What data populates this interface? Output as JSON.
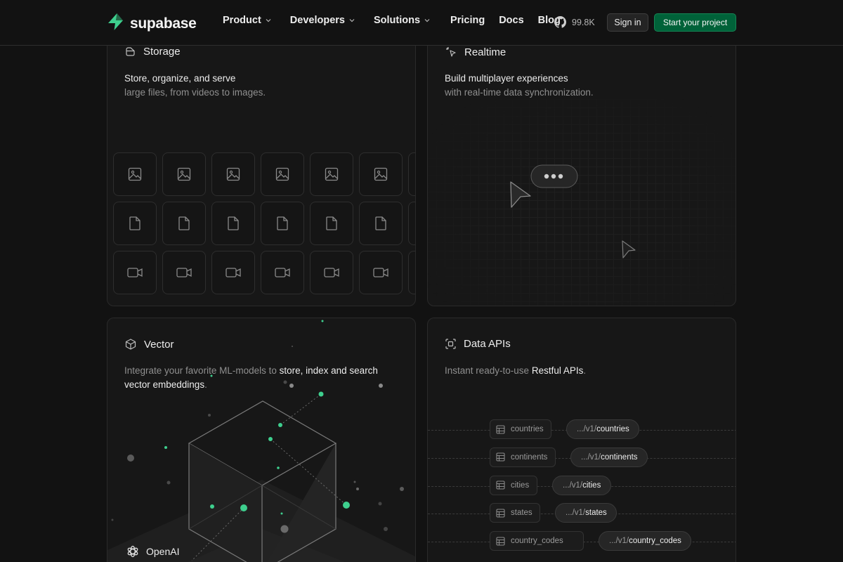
{
  "nav": {
    "brand": "supabase",
    "menu": [
      {
        "label": "Product",
        "dropdown": true
      },
      {
        "label": "Developers",
        "dropdown": true
      },
      {
        "label": "Solutions",
        "dropdown": true
      },
      {
        "label": "Pricing",
        "dropdown": false
      },
      {
        "label": "Docs",
        "dropdown": false
      },
      {
        "label": "Blog",
        "dropdown": false
      }
    ],
    "github_stars": "99.8K",
    "signin_label": "Sign in",
    "start_label": "Start your project"
  },
  "storage": {
    "title": "Storage",
    "desc_line1": "Store, organize, and serve",
    "desc_line2": "large files, from videos to images."
  },
  "realtime": {
    "title": "Realtime",
    "desc_line1": "Build multiplayer experiences",
    "desc_line2": "with real-time data synchronization."
  },
  "vector": {
    "title": "Vector",
    "desc_a": "Integrate your favorite ML-models to ",
    "desc_b": "store, index and search",
    "desc_c": "vector embeddings",
    "desc_d": ".",
    "provider": "OpenAI"
  },
  "apis": {
    "title": "Data APIs",
    "desc_a": "Instant ready-to-use ",
    "desc_b": "Restful APIs",
    "desc_c": ".",
    "rows": [
      {
        "table": "countries",
        "prefix": ".../v1/",
        "endpoint": "countries"
      },
      {
        "table": "continents",
        "prefix": ".../v1/",
        "endpoint": "continents"
      },
      {
        "table": "cities",
        "prefix": ".../v1/",
        "endpoint": "cities"
      },
      {
        "table": "states",
        "prefix": ".../v1/",
        "endpoint": "states"
      },
      {
        "table": "country_codes",
        "prefix": ".../v1/",
        "endpoint": "country_codes"
      }
    ]
  },
  "colors": {
    "brand_green": "#3ecf8e",
    "cta_bg": "#006239",
    "background": "#121212",
    "card": "#171717"
  },
  "icons": [
    "supabase-logo-icon",
    "chevron-down-icon",
    "github-icon",
    "storage-icon",
    "realtime-icon",
    "vector-icon",
    "data-apis-icon",
    "image-file-icon",
    "document-file-icon",
    "video-file-icon",
    "cursor-icon",
    "typing-bubble-icon",
    "table-icon",
    "openai-icon"
  ]
}
